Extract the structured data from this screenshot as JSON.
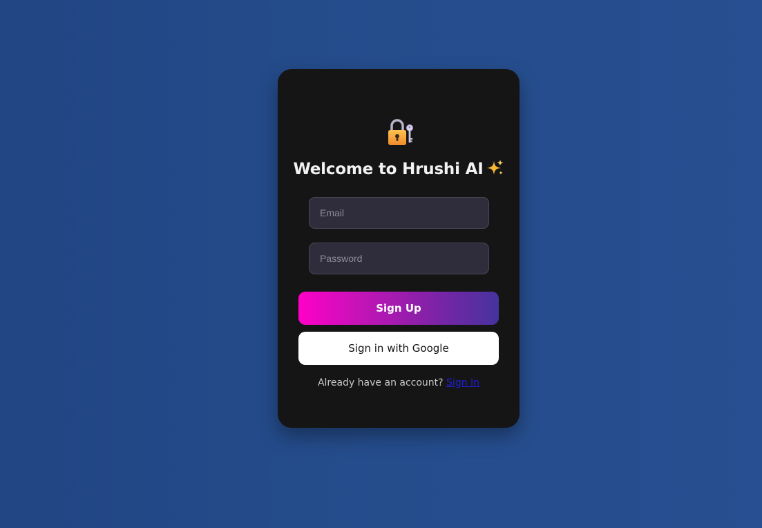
{
  "page": {
    "background_colors": [
      "#224583",
      "#274f91"
    ]
  },
  "card": {
    "background_color": "#151515",
    "icon": "locked-with-key-icon",
    "title": "Welcome to Hrushi AI",
    "title_icon": "sparkles-icon"
  },
  "form": {
    "email": {
      "placeholder": "Email",
      "value": ""
    },
    "password": {
      "placeholder": "Password",
      "value": ""
    },
    "signup_label": "Sign Up",
    "google_label": "Sign in with Google"
  },
  "footer": {
    "prompt": "Already have an account?",
    "link_label": "Sign In"
  },
  "colors": {
    "accent_start": "#ff00c8",
    "accent_end": "#46339e",
    "link": "#1f1fd8"
  }
}
